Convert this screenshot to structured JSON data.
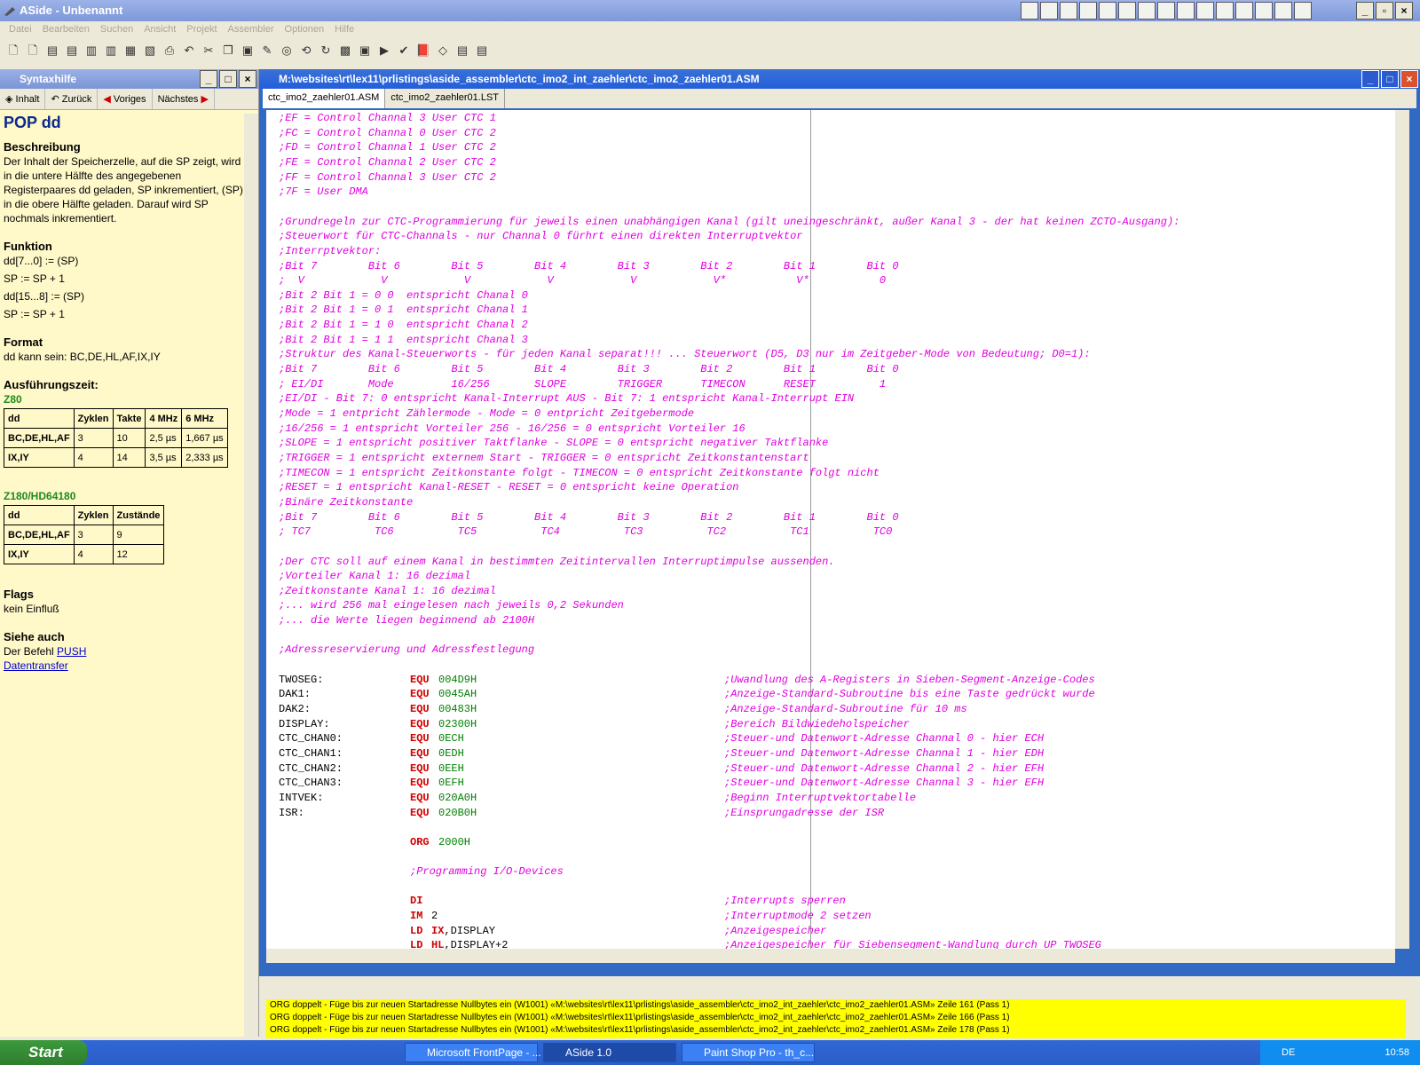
{
  "window": {
    "title": "ASide - Unbenannt"
  },
  "menu": [
    "Datei",
    "Bearbeiten",
    "Suchen",
    "Ansicht",
    "Projekt",
    "Assembler",
    "Optionen",
    "Hilfe"
  ],
  "syntax": {
    "pane_title": "Syntaxhilfe",
    "nav": {
      "inhalt": "Inhalt",
      "zurueck": "Zurück",
      "voriges": "Voriges",
      "naechstes": "Nächstes"
    },
    "heading": "POP dd",
    "beschreibung_label": "Beschreibung",
    "beschreibung_text": "Der Inhalt der Speicherzelle, auf die SP zeigt, wird in die untere Hälfte des angegebenen Registerpaares dd geladen, SP inkrementiert, (SP) in die obere Hälfte geladen. Darauf wird SP nochmals inkrementiert.",
    "funktion_label": "Funktion",
    "funktion_lines": [
      "dd[7...0] := (SP)",
      "SP := SP + 1",
      "dd[15...8] := (SP)",
      "SP := SP + 1"
    ],
    "format_label": "Format",
    "format_text": "dd kann sein: BC,DE,HL,AF,IX,IY",
    "zeit_label": "Ausführungszeit:",
    "z80_label": "Z80",
    "z80_headers": [
      "dd",
      "Zyklen",
      "Takte",
      "4 MHz",
      "6 MHz"
    ],
    "z80_rows": [
      [
        "BC,DE,HL,AF",
        "3",
        "10",
        "2,5 µs",
        "1,667 µs"
      ],
      [
        "IX,IY",
        "4",
        "14",
        "3,5 µs",
        "2,333 µs"
      ]
    ],
    "z180_label": "Z180/HD64180",
    "z180_headers": [
      "dd",
      "Zyklen",
      "Zustände"
    ],
    "z180_rows": [
      [
        "BC,DE,HL,AF",
        "3",
        "9"
      ],
      [
        "IX,IY",
        "4",
        "12"
      ]
    ],
    "flags_label": "Flags",
    "flags_text": "kein Einfluß",
    "siehe_label": "Siehe auch",
    "siehe_prefix": "Der Befehl",
    "siehe_link1": "PUSH",
    "siehe_link2": "Datentransfer"
  },
  "editor": {
    "title": "M:\\websites\\rt\\lex11\\prlistings\\aside_assembler\\ctc_imo2_int_zaehler\\ctc_imo2_zaehler01.ASM",
    "tabs": [
      "ctc_imo2_zaehler01.ASM",
      "ctc_imo2_zaehler01.LST"
    ],
    "comment_lines": [
      ";EF = Control Channal 3 User CTC 1",
      ";FC = Control Channal 0 User CTC 2",
      ";FD = Control Channal 1 User CTC 2",
      ";FE = Control Channal 2 User CTC 2",
      ";FF = Control Channal 3 User CTC 2",
      ";7F = User DMA",
      "",
      ";Grundregeln zur CTC-Programmierung für jeweils einen unabhängigen Kanal (gilt uneingeschränkt, außer Kanal 3 - der hat keinen ZCTO-Ausgang):",
      ";Steuerwort für CTC-Channals - nur Channal 0 fürhrt einen direkten Interruptvektor",
      ";Interrptvektor:",
      ";Bit 7        Bit 6        Bit 5        Bit 4        Bit 3        Bit 2        Bit 1        Bit 0",
      ";  V            V            V            V            V            V*           V*           0",
      ";Bit 2 Bit 1 = 0 0  entspricht Chanal 0",
      ";Bit 2 Bit 1 = 0 1  entspricht Chanal 1",
      ";Bit 2 Bit 1 = 1 0  entspricht Chanal 2",
      ";Bit 2 Bit 1 = 1 1  entspricht Chanal 3",
      ";Struktur des Kanal-Steuerworts - für jeden Kanal separat!!! ... Steuerwort (D5, D3 nur im Zeitgeber-Mode von Bedeutung; D0=1):",
      ";Bit 7        Bit 6        Bit 5        Bit 4        Bit 3        Bit 2        Bit 1        Bit 0",
      "; EI/DI       Mode         16/256       SLOPE        TRIGGER      TIMECON      RESET          1",
      ";EI/DI - Bit 7: 0 entspricht Kanal-Interrupt AUS - Bit 7: 1 entspricht Kanal-Interrupt EIN",
      ";Mode = 1 entpricht Zählermode - Mode = 0 entpricht Zeitgebermode",
      ";16/256 = 1 entspricht Vorteiler 256 - 16/256 = 0 entspricht Vorteiler 16",
      ";SLOPE = 1 entspricht positiver Taktflanke - SLOPE = 0 entspricht negativer Taktflanke",
      ";TRIGGER = 1 entspricht externem Start - TRIGGER = 0 entspricht Zeitkonstantenstart",
      ";TIMECON = 1 entspricht Zeitkonstante folgt - TIMECON = 0 entspricht Zeitkonstante folgt nicht",
      ";RESET = 1 entspricht Kanal-RESET - RESET = 0 entspricht keine Operation",
      ";Binäre Zeitkonstante",
      ";Bit 7        Bit 6        Bit 5        Bit 4        Bit 3        Bit 2        Bit 1        Bit 0",
      "; TC7          TC6          TC5          TC4          TC3          TC2          TC1          TC0",
      "",
      ";Der CTC soll auf einem Kanal in bestimmten Zeitintervallen Interruptimpulse aussenden.",
      ";Vorteiler Kanal 1: 16 dezimal",
      ";Zeitkonstante Kanal 1: 16 dezimal",
      ";... wird 256 mal eingelesen nach jeweils 0,2 Sekunden",
      ";... die Werte liegen beginnend ab 2100H",
      "",
      ";Adressreservierung und Adressfestlegung"
    ],
    "equ_lines": [
      {
        "label": "TWOSEG:",
        "kw": "EQU",
        "arg": "004D9H",
        "comment": ";Uwandlung des A-Registers in Sieben-Segment-Anzeige-Codes"
      },
      {
        "label": "DAK1:",
        "kw": "EQU",
        "arg": "0045AH",
        "comment": ";Anzeige-Standard-Subroutine bis eine Taste gedrückt wurde"
      },
      {
        "label": "DAK2:",
        "kw": "EQU",
        "arg": "00483H",
        "comment": ";Anzeige-Standard-Subroutine für 10 ms"
      },
      {
        "label": "DISPLAY:",
        "kw": "EQU",
        "arg": "02300H",
        "comment": ";Bereich Bildwiedeholspeicher"
      },
      {
        "label": "CTC_CHAN0:",
        "kw": "EQU",
        "arg": "0ECH",
        "comment": ";Steuer-und Datenwort-Adresse Channal 0 - hier ECH"
      },
      {
        "label": "CTC_CHAN1:",
        "kw": "EQU",
        "arg": "0EDH",
        "comment": ";Steuer-und Datenwort-Adresse Channal 1 - hier EDH"
      },
      {
        "label": "CTC_CHAN2:",
        "kw": "EQU",
        "arg": "0EEH",
        "comment": ";Steuer-und Datenwort-Adresse Channal 2 - hier EFH"
      },
      {
        "label": "CTC_CHAN3:",
        "kw": "EQU",
        "arg": "0EFH",
        "comment": ";Steuer-und Datenwort-Adresse Channal 3 - hier EFH"
      },
      {
        "label": "INTVEK:",
        "kw": "EQU",
        "arg": "020A0H",
        "comment": ";Beginn Interruptvektortabelle"
      },
      {
        "label": "ISR:",
        "kw": "EQU",
        "arg": "020B0H",
        "comment": ";Einsprungadresse der ISR"
      }
    ],
    "org": {
      "kw": "ORG",
      "arg": "2000H"
    },
    "prog_comment": ";Programming I/O-Devices",
    "instr_lines": [
      {
        "kw": "DI",
        "reg": "",
        "arg": "",
        "comment": ";Interrupts sperren"
      },
      {
        "kw": "IM",
        "reg": "",
        "arg": "2",
        "comment": ";Interruptmode 2 setzen"
      },
      {
        "kw": "LD",
        "reg": "IX",
        "arg": ",DISPLAY",
        "comment": ";Anzeigespeicher"
      },
      {
        "kw": "LD",
        "reg": "HL",
        "arg": ",DISPLAY+2",
        "comment": ";Anzeigespeicher für Siebensegment-Wandlung durch UP TWOSEG"
      }
    ]
  },
  "messages": [
    "ORG doppelt - Füge bis zur neuen Startadresse Nullbytes ein (W1001) «M:\\websites\\rt\\lex11\\prlistings\\aside_assembler\\ctc_imo2_int_zaehler\\ctc_imo2_zaehler01.ASM» Zeile 161 (Pass 1)",
    "ORG doppelt - Füge bis zur neuen Startadresse Nullbytes ein (W1001) «M:\\websites\\rt\\lex11\\prlistings\\aside_assembler\\ctc_imo2_int_zaehler\\ctc_imo2_zaehler01.ASM» Zeile 166 (Pass 1)",
    "ORG doppelt - Füge bis zur neuen Startadresse Nullbytes ein (W1001) «M:\\websites\\rt\\lex11\\prlistings\\aside_assembler\\ctc_imo2_int_zaehler\\ctc_imo2_zaehler01.ASM» Zeile 178 (Pass 1)"
  ],
  "taskbar": {
    "start": "Start",
    "tasks": [
      "Microsoft FrontPage - ...",
      "ASide 1.0",
      "Paint Shop Pro - th_c..."
    ],
    "lang": "DE",
    "clock": "10:58"
  }
}
